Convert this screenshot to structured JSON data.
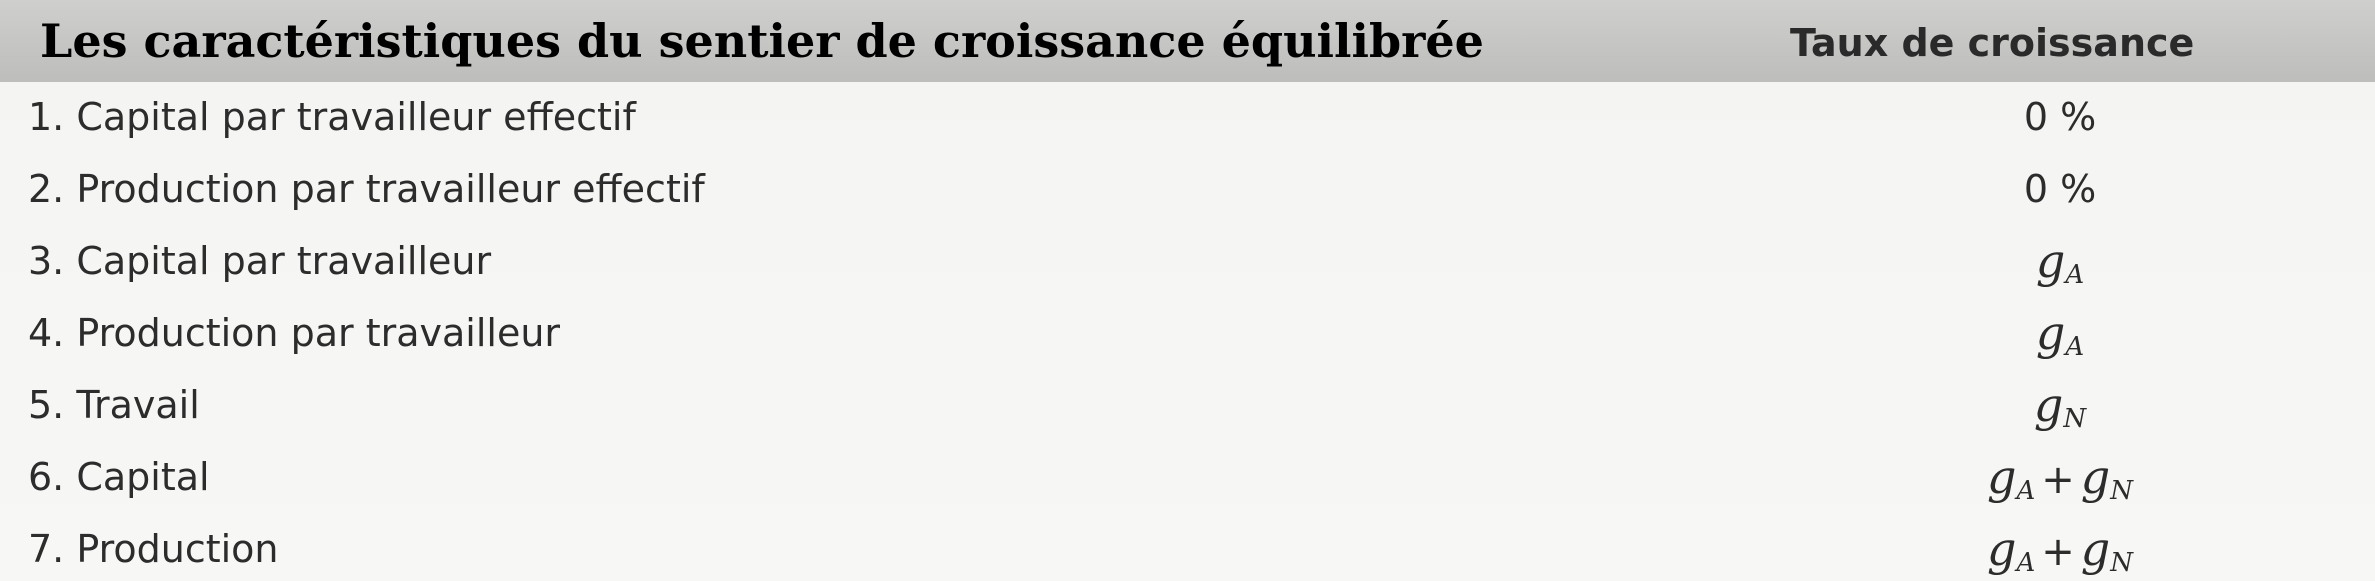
{
  "header": {
    "title": "Les caractéristiques du sentier de croissance équilibrée",
    "rate_label": "Taux de croissance"
  },
  "rows": [
    {
      "label": "1. Capital par travailleur effectif",
      "value": "0 %"
    },
    {
      "label": "2. Production par travailleur effectif",
      "value": "0 %"
    },
    {
      "label": "3. Capital par travailleur",
      "value_var": "g",
      "value_sub": "A"
    },
    {
      "label": "4. Production par travailleur",
      "value_var": "g",
      "value_sub": "A"
    },
    {
      "label": "5. Travail",
      "value_var": "g",
      "value_sub": "N"
    },
    {
      "label": "6. Capital",
      "value_var": "g",
      "value_sub": "A",
      "plus": "+",
      "value_var2": "g",
      "value_sub2": "N"
    },
    {
      "label": "7. Production",
      "value_var": "g",
      "value_sub": "A",
      "plus": "+",
      "value_var2": "g",
      "value_sub2": "N"
    }
  ]
}
